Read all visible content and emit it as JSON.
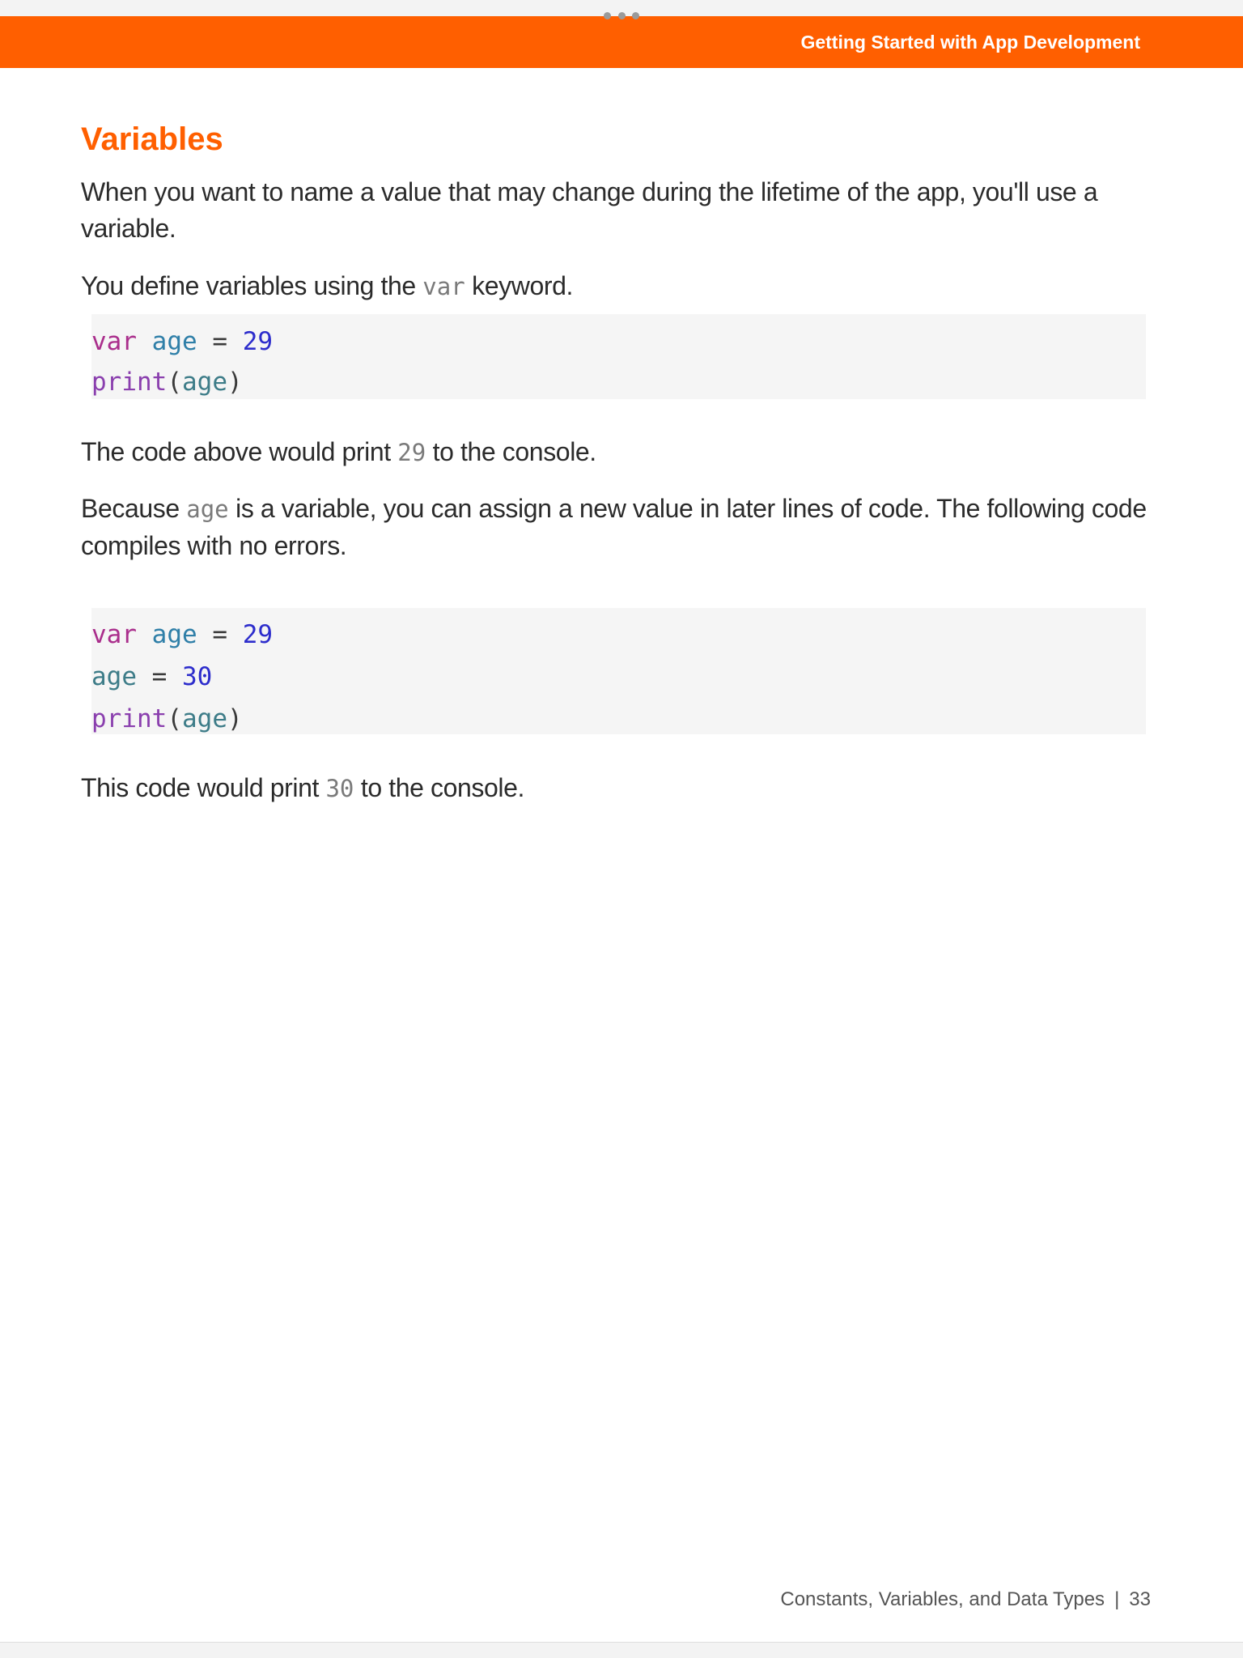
{
  "header": {
    "chapter_title": "Getting Started with App Development",
    "accent_color": "#ff5f00"
  },
  "section": {
    "title": "Variables"
  },
  "paragraphs": {
    "p1": "When you want to name a value that may change during the lifetime of the app, you'll use a variable.",
    "p2_before": "You define variables using the ",
    "p2_code": "var",
    "p2_after": " keyword.",
    "p3_before": "The code above would print ",
    "p3_code": "29",
    "p3_after": " to the console.",
    "p4_before": "Because ",
    "p4_code": "age",
    "p4_after": " is a variable, you can assign a new value in later lines of code. The following code compiles with no errors.",
    "p5_before": "This code would print ",
    "p5_code": "30",
    "p5_after": " to the console."
  },
  "code_block_1": {
    "line1": {
      "keyword": "var",
      "name": "age",
      "op": "=",
      "value": "29"
    },
    "line2": {
      "func": "print",
      "open": "(",
      "arg": "age",
      "close": ")"
    }
  },
  "code_block_2": {
    "line1": {
      "keyword": "var",
      "name": "age",
      "op": "=",
      "value": "29"
    },
    "line2": {
      "name": "age",
      "op": "=",
      "value": "30"
    },
    "line3": {
      "func": "print",
      "open": "(",
      "arg": "age",
      "close": ")"
    }
  },
  "footer": {
    "chapter": "Constants, Variables, and Data Types",
    "separator": "|",
    "page_number": "33"
  }
}
